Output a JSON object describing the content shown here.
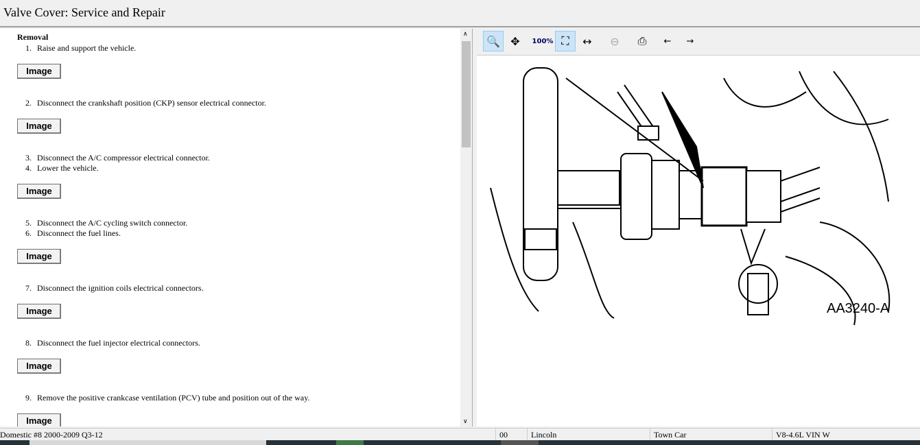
{
  "title": "Valve Cover:  Service and Repair",
  "section": "Removal",
  "image_label": "Image",
  "steps": [
    {
      "n": "1.",
      "t": "Raise and support the vehicle."
    },
    {
      "n": "2.",
      "t": "Disconnect the crankshaft position (CKP) sensor electrical connector."
    },
    {
      "n": "3.",
      "t": "Disconnect the A/C compressor electrical connector."
    },
    {
      "n": "4.",
      "t": "Lower the vehicle."
    },
    {
      "n": "5.",
      "t": "Disconnect the A/C cycling switch connector."
    },
    {
      "n": "6.",
      "t": "Disconnect the fuel lines."
    },
    {
      "n": "7.",
      "t": "Disconnect the ignition coils electrical connectors."
    },
    {
      "n": "8.",
      "t": "Disconnect the fuel injector electrical connectors."
    },
    {
      "n": "9.",
      "t": "Remove the positive crankcase ventilation (PCV) tube and position out of the way."
    }
  ],
  "toolbar": [
    "zoom-in",
    "pan",
    "actual-size",
    "fit",
    "zoom-width",
    "zoom-out",
    "print",
    "previous-image",
    "next-image"
  ],
  "figure_label": "AA3240-A",
  "status": {
    "database": "Domestic #8 2000-2009 Q3-12",
    "code": "00",
    "make": "Lincoln",
    "model": "Town Car",
    "engine": "V8-4.6L VIN W"
  }
}
